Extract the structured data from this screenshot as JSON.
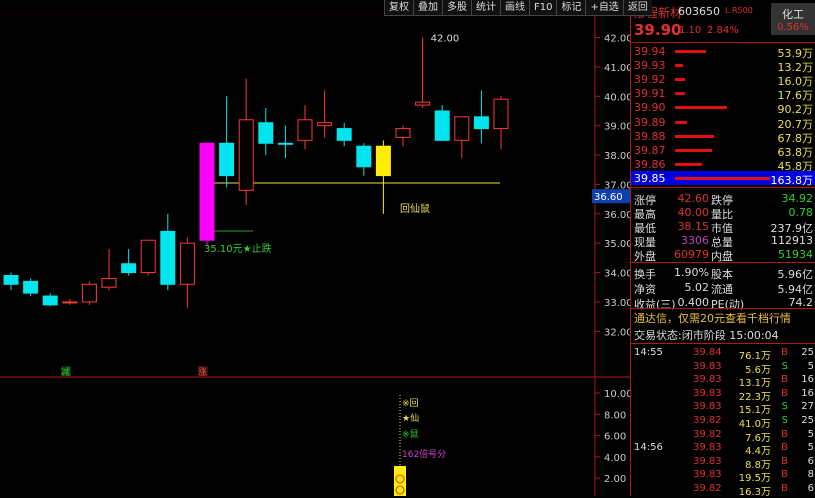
{
  "toolbar": [
    "复权",
    "叠加",
    "多股",
    "统计",
    "画线",
    "F10",
    "标记",
    "+自选",
    "返回"
  ],
  "stock": {
    "name": "彤程新材",
    "code": "603650",
    "flag": "L R500",
    "sector": "化工",
    "sector_pct": "0.56%",
    "price": "39.90",
    "change": "1.10",
    "change_pct": "2.84%"
  },
  "asks": [
    {
      "price": "39.94",
      "vol": "53.9万",
      "bar": 0.33
    },
    {
      "price": "39.93",
      "vol": "13.2万",
      "bar": 0.08
    },
    {
      "price": "39.92",
      "vol": "16.0万",
      "bar": 0.1
    },
    {
      "price": "39.91",
      "vol": "17.6万",
      "bar": 0.11
    },
    {
      "price": "39.90",
      "vol": "90.2万",
      "bar": 0.55
    }
  ],
  "bids": [
    {
      "price": "39.89",
      "vol": "20.7万",
      "bar": 0.13
    },
    {
      "price": "39.88",
      "vol": "67.8万",
      "bar": 0.41
    },
    {
      "price": "39.87",
      "vol": "63.8万",
      "bar": 0.39
    },
    {
      "price": "39.86",
      "vol": "45.8万",
      "bar": 0.28
    },
    {
      "price": "39.85",
      "vol": "163.8万",
      "bar": 1.0
    }
  ],
  "stats": [
    {
      "l1": "涨停",
      "v1": "42.60",
      "c1": "#e03030",
      "l2": "跌停",
      "v2": "34.92",
      "c2": "#30d030"
    },
    {
      "l1": "最高",
      "v1": "40.00",
      "c1": "#e03030",
      "l2": "量比",
      "v2": "0.78",
      "c2": "#30d030"
    },
    {
      "l1": "最低",
      "v1": "38.15",
      "c1": "#e03030",
      "l2": "市值",
      "v2": "237.9亿",
      "c2": "#ddd"
    },
    {
      "l1": "现量",
      "v1": "3306",
      "c1": "#c040c0",
      "l2": "总量",
      "v2": "112913",
      "c2": "#ddd"
    },
    {
      "l1": "外盘",
      "v1": "60979",
      "c1": "#e03030",
      "l2": "内盘",
      "v2": "51934",
      "c2": "#30d030"
    }
  ],
  "stats2": [
    {
      "l1": "换手",
      "v1": "1.90%",
      "l2": "股本",
      "v2": "5.96亿"
    },
    {
      "l1": "净资",
      "v1": "5.02",
      "l2": "流通",
      "v2": "5.94亿"
    },
    {
      "l1": "收益(三)",
      "v1": "0.400",
      "l2": "PE(动)",
      "v2": "74.2"
    }
  ],
  "notice": "通达信，仅需20元查看千档行情",
  "state_label": "交易状态:",
  "state_value": "闭市阶段 15:00:04",
  "trades": [
    {
      "t": "14:55",
      "p": "39.84",
      "v": "76.1万",
      "s": "B",
      "n": "25"
    },
    {
      "t": "",
      "p": "39.83",
      "v": "5.6万",
      "s": "S",
      "n": "5"
    },
    {
      "t": "",
      "p": "39.83",
      "v": "13.1万",
      "s": "B",
      "n": "16"
    },
    {
      "t": "",
      "p": "39.83",
      "v": "22.3万",
      "s": "B",
      "n": "16"
    },
    {
      "t": "",
      "p": "39.83",
      "v": "15.1万",
      "s": "S",
      "n": "27"
    },
    {
      "t": "",
      "p": "39.82",
      "v": "41.0万",
      "s": "S",
      "n": "25"
    },
    {
      "t": "",
      "p": "39.82",
      "v": "7.6万",
      "s": "B",
      "n": "5"
    },
    {
      "t": "14:56",
      "p": "39.83",
      "v": "4.4万",
      "s": "B",
      "n": "5"
    },
    {
      "t": "",
      "p": "39.83",
      "v": "8.8万",
      "s": "B",
      "n": "6"
    },
    {
      "t": "",
      "p": "39.83",
      "v": "19.5万",
      "s": "B",
      "n": "8"
    },
    {
      "t": "",
      "p": "39.82",
      "v": "16.3万",
      "s": "B",
      "n": "6"
    }
  ],
  "chart_data": {
    "type": "candlestick",
    "y_ticks": [
      "42.00",
      "41.00",
      "40.00",
      "39.00",
      "38.00",
      "37.00",
      "36.00",
      "35.00",
      "34.00",
      "33.00",
      "32.00"
    ],
    "y_range": [
      31.5,
      42.8
    ],
    "ind_ticks": [
      "10.00",
      "8.00",
      "6.00",
      "4.00",
      "2.00"
    ],
    "current_price_label": "36.60",
    "high_marker": "42.00",
    "annotations": {
      "stop": "35.10元★止跌",
      "signal": "回仙鼠",
      "reduce": "减",
      "rise": "涨",
      "ind1": "※回",
      "ind2": "★仙",
      "ind3": "※鼠",
      "ind4": "162倍号分"
    },
    "candles": [
      {
        "o": 33.6,
        "c": 33.9,
        "h": 34.0,
        "l": 33.4,
        "color": "cyan"
      },
      {
        "o": 33.7,
        "c": 33.3,
        "h": 33.8,
        "l": 33.2,
        "color": "cyan"
      },
      {
        "o": 33.2,
        "c": 32.9,
        "h": 33.3,
        "l": 32.85,
        "color": "cyan"
      },
      {
        "o": 33.0,
        "c": 33.0,
        "h": 33.1,
        "l": 32.9,
        "color": "red"
      },
      {
        "o": 33.0,
        "c": 33.6,
        "h": 33.7,
        "l": 32.9,
        "color": "red"
      },
      {
        "o": 33.5,
        "c": 33.8,
        "h": 34.8,
        "l": 33.4,
        "color": "red"
      },
      {
        "o": 34.3,
        "c": 34.0,
        "h": 34.8,
        "l": 33.9,
        "color": "cyan"
      },
      {
        "o": 34.0,
        "c": 35.1,
        "h": 35.1,
        "l": 33.9,
        "color": "red"
      },
      {
        "o": 35.4,
        "c": 33.6,
        "h": 36.0,
        "l": 33.4,
        "color": "cyan"
      },
      {
        "o": 33.6,
        "c": 35.0,
        "h": 35.2,
        "l": 32.8,
        "color": "red"
      },
      {
        "o": 35.1,
        "c": 38.4,
        "h": 38.4,
        "l": 34.9,
        "color": "magenta"
      },
      {
        "o": 38.4,
        "c": 37.3,
        "h": 40.0,
        "l": 36.9,
        "color": "cyan"
      },
      {
        "o": 36.8,
        "c": 39.2,
        "h": 40.6,
        "l": 36.3,
        "color": "red"
      },
      {
        "o": 39.1,
        "c": 38.4,
        "h": 39.6,
        "l": 38.0,
        "color": "cyan"
      },
      {
        "o": 38.4,
        "c": 38.4,
        "h": 39.0,
        "l": 37.9,
        "color": "cyan"
      },
      {
        "o": 38.5,
        "c": 39.2,
        "h": 39.7,
        "l": 38.2,
        "color": "red"
      },
      {
        "o": 39.1,
        "c": 39.0,
        "h": 40.2,
        "l": 38.6,
        "color": "red"
      },
      {
        "o": 38.9,
        "c": 38.5,
        "h": 39.1,
        "l": 38.3,
        "color": "cyan"
      },
      {
        "o": 38.3,
        "c": 37.6,
        "h": 38.4,
        "l": 37.3,
        "color": "cyan"
      },
      {
        "o": 37.3,
        "c": 38.3,
        "h": 38.5,
        "l": 36.0,
        "color": "yellow"
      },
      {
        "o": 38.6,
        "c": 38.9,
        "h": 39.0,
        "l": 38.3,
        "color": "red"
      },
      {
        "o": 39.7,
        "c": 39.8,
        "h": 42.0,
        "l": 39.6,
        "color": "red"
      },
      {
        "o": 38.5,
        "c": 39.5,
        "h": 39.7,
        "l": 38.5,
        "color": "cyan"
      },
      {
        "o": 38.5,
        "c": 39.3,
        "h": 39.3,
        "l": 37.9,
        "color": "red"
      },
      {
        "o": 39.3,
        "c": 38.9,
        "h": 40.2,
        "l": 38.4,
        "color": "cyan"
      },
      {
        "o": 38.9,
        "c": 39.9,
        "h": 40.0,
        "l": 38.2,
        "color": "red"
      }
    ]
  }
}
